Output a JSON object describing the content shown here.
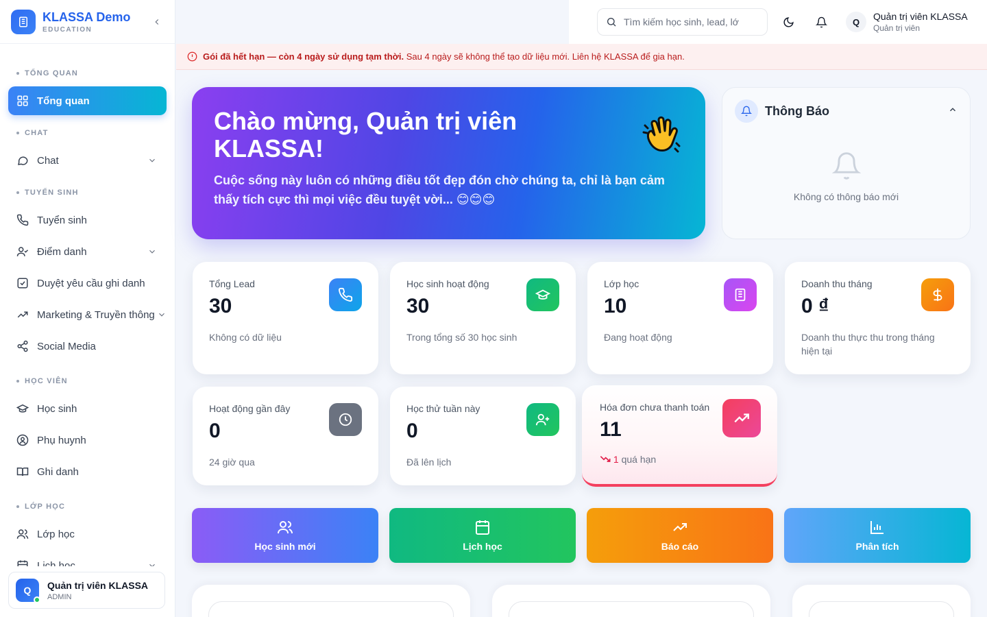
{
  "brand": {
    "name": "KLASSA Demo",
    "sub": "EDUCATION"
  },
  "sidebar": {
    "sections": [
      {
        "label": "TỔNG QUAN",
        "items": [
          {
            "label": "Tổng quan",
            "icon": "grid-icon",
            "active": true
          }
        ]
      },
      {
        "label": "CHAT",
        "items": [
          {
            "label": "Chat",
            "icon": "chat-icon",
            "chevron": true
          }
        ]
      },
      {
        "label": "TUYỂN SINH",
        "items": [
          {
            "label": "Tuyển sinh",
            "icon": "phone-icon"
          },
          {
            "label": "Điểm danh",
            "icon": "user-check-icon",
            "chevron": true
          },
          {
            "label": "Duyệt yêu cầu ghi danh",
            "icon": "checkbox-icon"
          },
          {
            "label": "Marketing & Truyền thông",
            "icon": "trend-icon",
            "chevron": true
          },
          {
            "label": "Social Media",
            "icon": "share-icon"
          }
        ]
      },
      {
        "label": "HỌC VIÊN",
        "items": [
          {
            "label": "Học sinh",
            "icon": "graduation-icon"
          },
          {
            "label": "Phụ huynh",
            "icon": "user-circle-icon"
          },
          {
            "label": "Ghi danh",
            "icon": "book-icon"
          }
        ]
      },
      {
        "label": "LỚP HỌC",
        "items": [
          {
            "label": "Lớp học",
            "icon": "users-icon"
          },
          {
            "label": "Lịch học",
            "icon": "calendar-icon",
            "chevron": true
          }
        ]
      }
    ],
    "user": {
      "initial": "Q",
      "name": "Quản trị viên KLASSA",
      "role": "ADMIN"
    }
  },
  "topbar": {
    "search_placeholder": "Tìm kiếm học sinh, lead, lớ",
    "user": {
      "initial": "Q",
      "name": "Quản trị viên KLASSA",
      "role": "Quản trị viên"
    }
  },
  "alert": {
    "strong": "Gói đã hết hạn — còn 4 ngày sử dụng tạm thời.",
    "text": "Sau 4 ngày sẽ không thể tạo dữ liệu mới. Liên hệ KLASSA để gia hạn."
  },
  "hero": {
    "title": "Chào mừng, Quản trị viên KLASSA!",
    "message": "Cuộc sống này luôn có những điều tốt đẹp đón chờ chúng ta, chỉ là bạn cảm thấy tích cực thì mọi việc đều tuyệt vời... 😊😊😊"
  },
  "notifications": {
    "title": "Thông Báo",
    "empty": "Không có thông báo mới"
  },
  "stats": {
    "total_lead": {
      "title": "Tổng Lead",
      "value": "30",
      "desc": "Không có dữ liệu"
    },
    "active_students": {
      "title": "Học sinh hoạt động",
      "value": "30",
      "desc": "Trong tổng số 30 học sinh"
    },
    "classes": {
      "title": "Lớp học",
      "value": "10",
      "desc": "Đang hoạt động"
    },
    "revenue": {
      "title": "Doanh thu tháng",
      "value": "0 ₫",
      "desc": "Doanh thu thực thu trong tháng hiện tại"
    },
    "recent": {
      "title": "Hoạt động gần đây",
      "value": "0",
      "desc": "24 giờ qua"
    },
    "trial": {
      "title": "Học thử tuần này",
      "value": "0",
      "desc": "Đã lên lịch"
    },
    "unpaid": {
      "title": "Hóa đơn chưa thanh toán",
      "value": "11",
      "overdue_count": "1",
      "overdue_text": "quá hạn"
    }
  },
  "actions": {
    "new_student": "Học sinh mới",
    "schedule": "Lịch học",
    "report": "Báo cáo",
    "analytics": "Phân tích"
  },
  "colors": {
    "primary": "#2563eb",
    "alert_text": "#b91c1c",
    "stat_lead": "#3b82f6",
    "stat_students": "#10b981",
    "stat_classes": "#c026d3",
    "stat_revenue": "#f59e0b",
    "stat_recent": "#6b7280",
    "stat_trial": "#22c55e",
    "stat_unpaid": "#f43f5e"
  }
}
